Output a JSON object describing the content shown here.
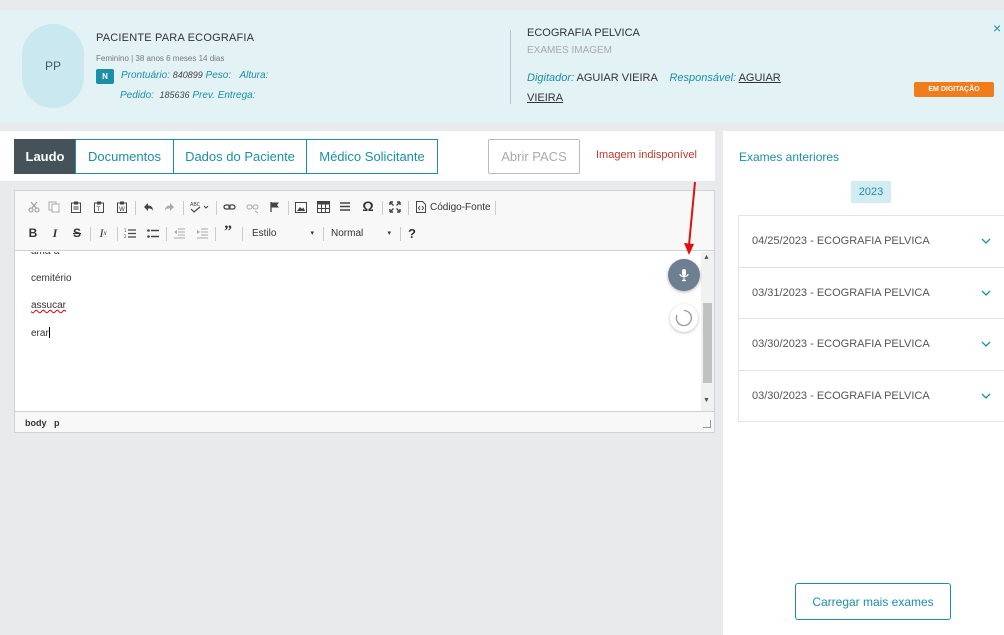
{
  "patient": {
    "initials": "PP",
    "name": "PACIENTE PARA ECOGRAFIA",
    "info": "Feminino | 38 anos 6 meses 14 dias",
    "badge": "N",
    "prontuario_label": "Prontuário:",
    "prontuario": "840899",
    "peso_label": "Peso:",
    "altura_label": "Altura:",
    "pedido_label": "Pedido:",
    "pedido": "185636",
    "prev_entrega_label": "Prev. Entrega:"
  },
  "exam": {
    "name": "ECOGRAFIA PELVICA",
    "type": "EXAMES IMAGEM",
    "digitador_label": "Digitador:",
    "digitador": "AGUIAR VIEIRA",
    "responsavel_label": "Responsável:",
    "responsavel_part1": "AGUIAR",
    "responsavel_part2": "VIEIRA",
    "status": "EM DIGITAÇÃO",
    "close": "×"
  },
  "tabs": [
    {
      "label": "Laudo"
    },
    {
      "label": "Documentos"
    },
    {
      "label": "Dados do Paciente"
    },
    {
      "label": "Médico Solicitante"
    }
  ],
  "actions": {
    "abrir_pacs": "Abrir PACS",
    "imagem_indisponivel": "Imagem indisponível"
  },
  "editor": {
    "codigo_fonte": "Código-Fonte",
    "estilo": "Estilo",
    "formato": "Normal",
    "help": "?",
    "lines": [
      "ama-a",
      "cemitério",
      "assucar",
      "erar"
    ],
    "path_body": "body",
    "path_p": "p"
  },
  "history": {
    "title": "Exames anteriores",
    "year": "2023",
    "items": [
      "04/25/2023 - ECOGRAFIA PELVICA",
      "03/31/2023 - ECOGRAFIA PELVICA",
      "03/30/2023 - ECOGRAFIA PELVICA",
      "03/30/2023 - ECOGRAFIA PELVICA"
    ],
    "load_more": "Carregar mais exames"
  },
  "colors": {
    "accent": "#1b8fa6",
    "header_bg": "#e3f2f5",
    "status_orange": "#f07c1c",
    "error_red": "#c0392b",
    "active_tab": "#46525a"
  },
  "icons": [
    "cut-icon",
    "copy-icon",
    "paste-icon",
    "paste-text-icon",
    "paste-word-icon",
    "undo-icon",
    "redo-icon",
    "spellcheck-icon",
    "link-icon",
    "unlink-icon",
    "anchor-icon",
    "image-icon",
    "table-icon",
    "horizontal-rule-icon",
    "special-char-icon",
    "maximize-icon",
    "source-icon",
    "bold-icon",
    "italic-icon",
    "strike-icon",
    "remove-format-icon",
    "numbered-list-icon",
    "bullet-list-icon",
    "outdent-icon",
    "indent-icon",
    "blockquote-icon",
    "microphone-icon",
    "spinner-icon",
    "chevron-down-icon"
  ]
}
